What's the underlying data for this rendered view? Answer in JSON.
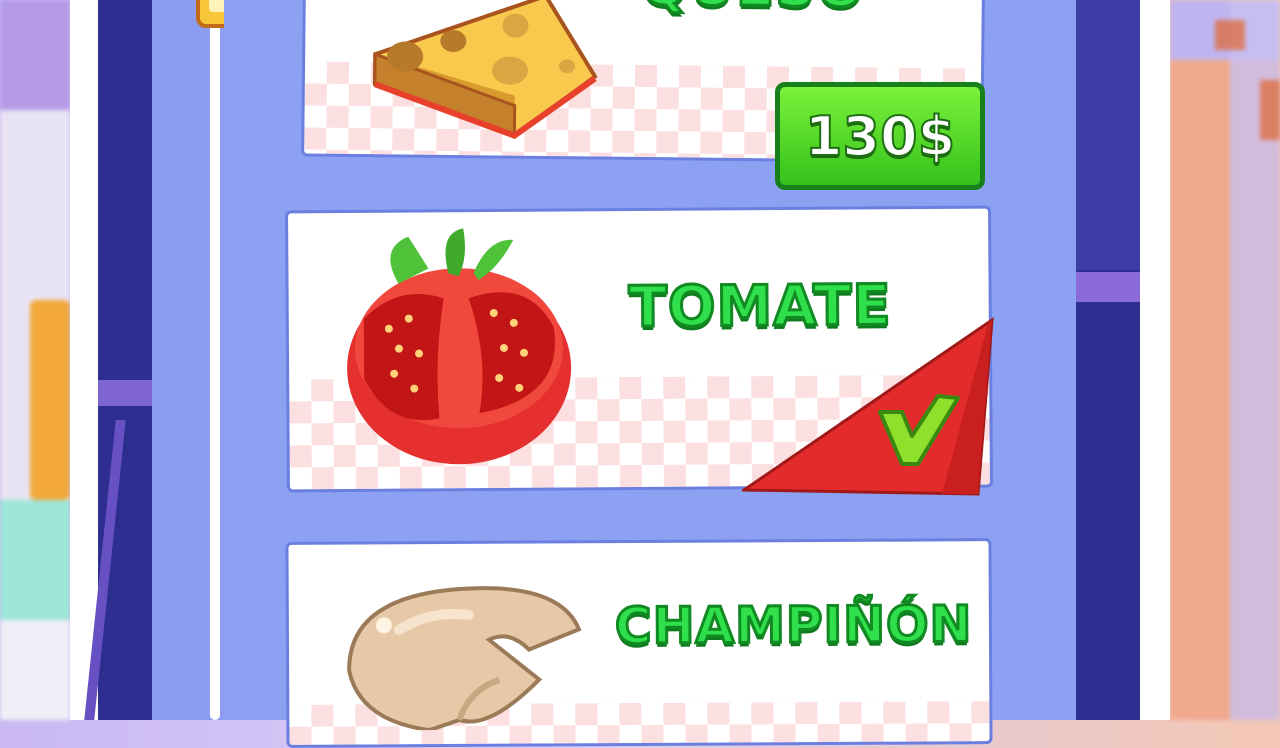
{
  "items": [
    {
      "name": "QUESO",
      "price": "130$",
      "state": "locked"
    },
    {
      "name": "TOMATE",
      "state": "owned",
      "badge_icon": "check-icon"
    },
    {
      "name": "CHAMPIÑÓN",
      "state": "unknown"
    }
  ],
  "colors": {
    "title_green": "#2fe04c",
    "price_green": "#35c21b",
    "owned_red": "#e32b2b",
    "panel": "#8da1f2",
    "shelf": "#2d2e8f"
  }
}
